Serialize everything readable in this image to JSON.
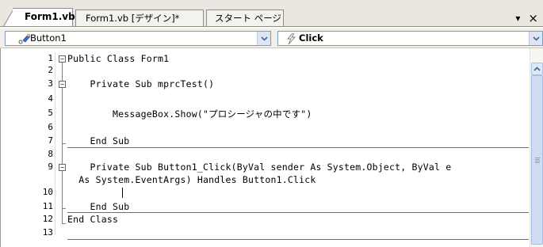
{
  "tabs": [
    {
      "label": "Form1.vb*",
      "active": true
    },
    {
      "label": "Form1.vb [デザイン]*",
      "active": false
    },
    {
      "label": "スタート ページ",
      "active": false
    }
  ],
  "tab_controls": {
    "dropdown_glyph": "▾",
    "close_glyph": "×"
  },
  "class_combo": {
    "value": "Button1",
    "icon": "control-icon"
  },
  "method_combo": {
    "value": "Click",
    "icon": "event-lightning-icon"
  },
  "lines": [
    {
      "num": "1",
      "code": "Public Class Form1"
    },
    {
      "num": "2",
      "code": ""
    },
    {
      "num": "3",
      "code": "    Private Sub mprcTest()"
    },
    {
      "num": "4",
      "code": ""
    },
    {
      "num": "5",
      "code": "        MessageBox.Show(\"プロシージャの中です\")"
    },
    {
      "num": "6",
      "code": ""
    },
    {
      "num": "7",
      "code": "    End Sub"
    },
    {
      "num": "8",
      "code": ""
    },
    {
      "num": "9",
      "code": "    Private Sub Button1_Click(ByVal sender As System.Object, ByVal e"
    },
    {
      "num": "",
      "code": "  As System.EventArgs) Handles Button1.Click"
    },
    {
      "num": "10",
      "code": ""
    },
    {
      "num": "11",
      "code": "    End Sub"
    },
    {
      "num": "12",
      "code": "End Class"
    },
    {
      "num": "13",
      "code": ""
    }
  ],
  "colors": {
    "accent": "#7f9db9",
    "scrollbar": "#cfdcf3"
  }
}
